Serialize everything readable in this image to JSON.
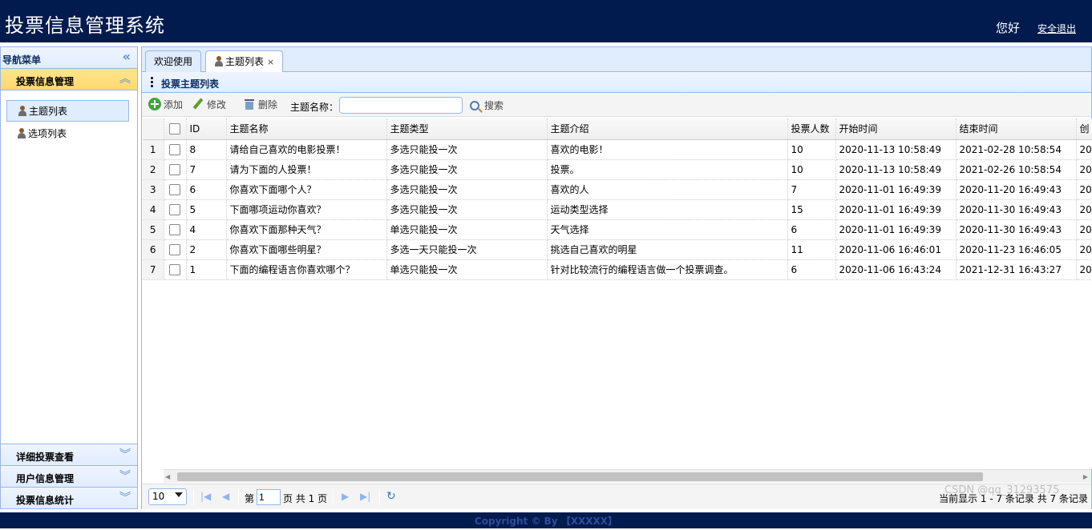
{
  "header": {
    "app_title": "投票信息管理系统",
    "greeting": "您好",
    "logout_label": "安全退出"
  },
  "sidebar": {
    "title": "导航菜单",
    "active_section": "投票信息管理",
    "items": [
      {
        "label": "主题列表",
        "selected": true
      },
      {
        "label": "选项列表",
        "selected": false
      }
    ],
    "collapsed_sections": [
      "详细投票查看",
      "用户信息管理",
      "投票信息统计"
    ]
  },
  "tabs": [
    {
      "label": "欢迎使用",
      "active": false
    },
    {
      "label": "主题列表",
      "active": true,
      "closable": true
    }
  ],
  "panel": {
    "title": "投票主题列表"
  },
  "toolbar": {
    "add_label": "添加",
    "edit_label": "修改",
    "delete_label": "删除",
    "search_label": "主题名称：",
    "search_value": "",
    "search_button": "搜索"
  },
  "grid": {
    "columns": [
      "ID",
      "主题名称",
      "主题类型",
      "主题介绍",
      "投票人数",
      "开始时间",
      "结束时间",
      "创"
    ],
    "rows": [
      {
        "num": "1",
        "id": "8",
        "name": "请给自己喜欢的电影投票！",
        "type": "多选只能投一次",
        "intro": "喜欢的电影！",
        "votes": "10",
        "start": "2020-11-13 10:58:49",
        "end": "2021-02-28 10:58:54",
        "created": "20"
      },
      {
        "num": "2",
        "id": "7",
        "name": "请为下面的人投票！",
        "type": "多选只能投一次",
        "intro": "投票。",
        "votes": "10",
        "start": "2020-11-13 10:58:49",
        "end": "2021-02-26 10:58:54",
        "created": "20"
      },
      {
        "num": "3",
        "id": "6",
        "name": "你喜欢下面哪个人？",
        "type": "多选只能投一次",
        "intro": "喜欢的人",
        "votes": "7",
        "start": "2020-11-01 16:49:39",
        "end": "2020-11-20 16:49:43",
        "created": "20"
      },
      {
        "num": "4",
        "id": "5",
        "name": "下面哪项运动你喜欢？",
        "type": "多选只能投一次",
        "intro": "运动类型选择",
        "votes": "15",
        "start": "2020-11-01 16:49:39",
        "end": "2020-11-30 16:49:43",
        "created": "20"
      },
      {
        "num": "5",
        "id": "4",
        "name": "你喜欢下面那种天气？",
        "type": "单选只能投一次",
        "intro": "天气选择",
        "votes": "6",
        "start": "2020-11-01 16:49:39",
        "end": "2020-11-30 16:49:43",
        "created": "20"
      },
      {
        "num": "6",
        "id": "2",
        "name": "你喜欢下面哪些明星？",
        "type": "多选一天只能投一次",
        "intro": "挑选自己喜欢的明星",
        "votes": "11",
        "start": "2020-11-06 16:46:01",
        "end": "2020-11-23 16:46:05",
        "created": "20"
      },
      {
        "num": "7",
        "id": "1",
        "name": "下面的编程语言你喜欢哪个？",
        "type": "单选只能投一次",
        "intro": "针对比较流行的编程语言做一个投票调查。",
        "votes": "6",
        "start": "2020-11-06 16:43:24",
        "end": "2021-12-31 16:43:27",
        "created": "20"
      }
    ]
  },
  "pager": {
    "page_size": "10",
    "page_prefix": "第",
    "current_page": "1",
    "page_suffix": "页 共 1 页",
    "info": "当前显示 1 - 7 条记录 共 7 条记录"
  },
  "footer": {
    "copyright": "Copyright © By 【XXXXX】"
  },
  "watermark": "CSDN @qq_31293575",
  "colors": {
    "header_bg": "#021b4f",
    "border": "#95b8e7",
    "active_accordion": "#ffd970"
  }
}
